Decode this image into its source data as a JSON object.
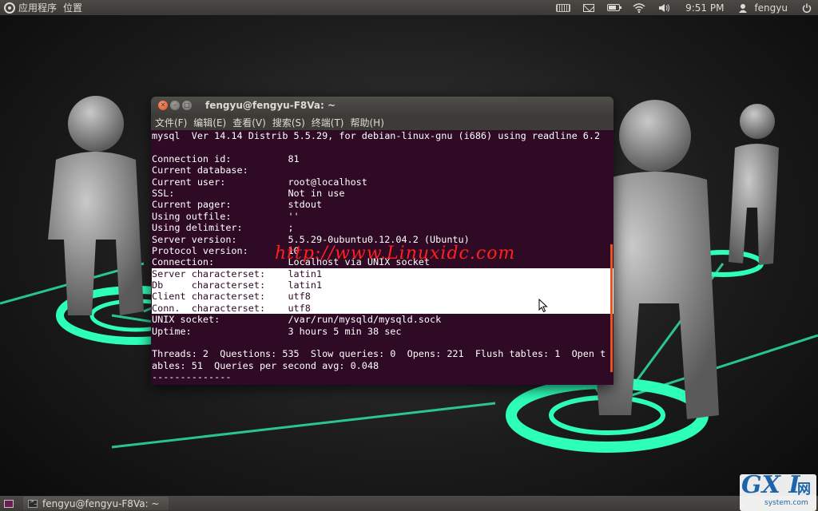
{
  "top_panel": {
    "menus": [
      "应用程序",
      "位置"
    ],
    "clock": "9:51 PM",
    "user": "fengyu",
    "tray_icons": [
      "keyboard-icon",
      "mail-icon",
      "battery-icon",
      "wifi-icon",
      "volume-icon"
    ]
  },
  "terminal": {
    "title": "fengyu@fengyu-F8Va: ~",
    "menus": [
      "文件(F)",
      "编辑(E)",
      "查看(V)",
      "搜索(S)",
      "终端(T)",
      "帮助(H)"
    ],
    "lines": [
      "mysql  Ver 14.14 Distrib 5.5.29, for debian-linux-gnu (i686) using readline 6.2",
      "",
      "Connection id:          81",
      "Current database:",
      "Current user:           root@localhost",
      "SSL:                    Not in use",
      "Current pager:          stdout",
      "Using outfile:          ''",
      "Using delimiter:        ;",
      "Server version:         5.5.29-0ubuntu0.12.04.2 (Ubuntu)",
      "Protocol version:       10",
      "Connection:             Localhost via UNIX socket",
      "Server characterset:    latin1",
      "Db     characterset:    latin1",
      "Client characterset:    utf8",
      "Conn.  characterset:    utf8",
      "UNIX socket:            /var/run/mysqld/mysqld.sock",
      "Uptime:                 3 hours 5 min 38 sec",
      "",
      "Threads: 2  Questions: 535  Slow queries: 0  Opens: 221  Flush tables: 1  Open t",
      "ables: 51  Queries per second avg: 0.048",
      "--------------"
    ],
    "selected_lines": [
      12,
      13,
      14,
      15
    ]
  },
  "watermark": "http://www.Linuxidc.com",
  "bottom_panel": {
    "task": "fengyu@fengyu-F8Va: ~"
  },
  "site_logo": {
    "text": "GX I",
    "cn": "网",
    "sub": "system.com"
  },
  "colors": {
    "terminal_bg": "#300a24",
    "panel_bg": "#3c3b37",
    "accent": "#e95420",
    "glow": "#2effb8"
  }
}
